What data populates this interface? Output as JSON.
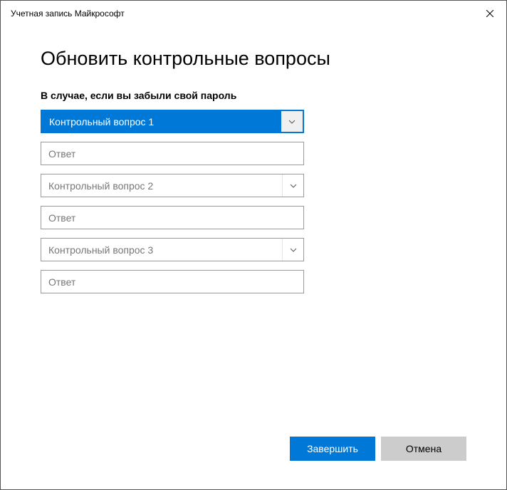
{
  "window": {
    "title": "Учетная запись Майкрософт"
  },
  "main": {
    "heading": "Обновить контрольные вопросы",
    "subheading": "В случае, если вы забыли свой пароль",
    "questions": [
      {
        "placeholder": "Контрольный вопрос 1",
        "answer_placeholder": "Ответ"
      },
      {
        "placeholder": "Контрольный вопрос 2",
        "answer_placeholder": "Ответ"
      },
      {
        "placeholder": "Контрольный вопрос 3",
        "answer_placeholder": "Ответ"
      }
    ]
  },
  "buttons": {
    "primary": "Завершить",
    "secondary": "Отмена"
  }
}
